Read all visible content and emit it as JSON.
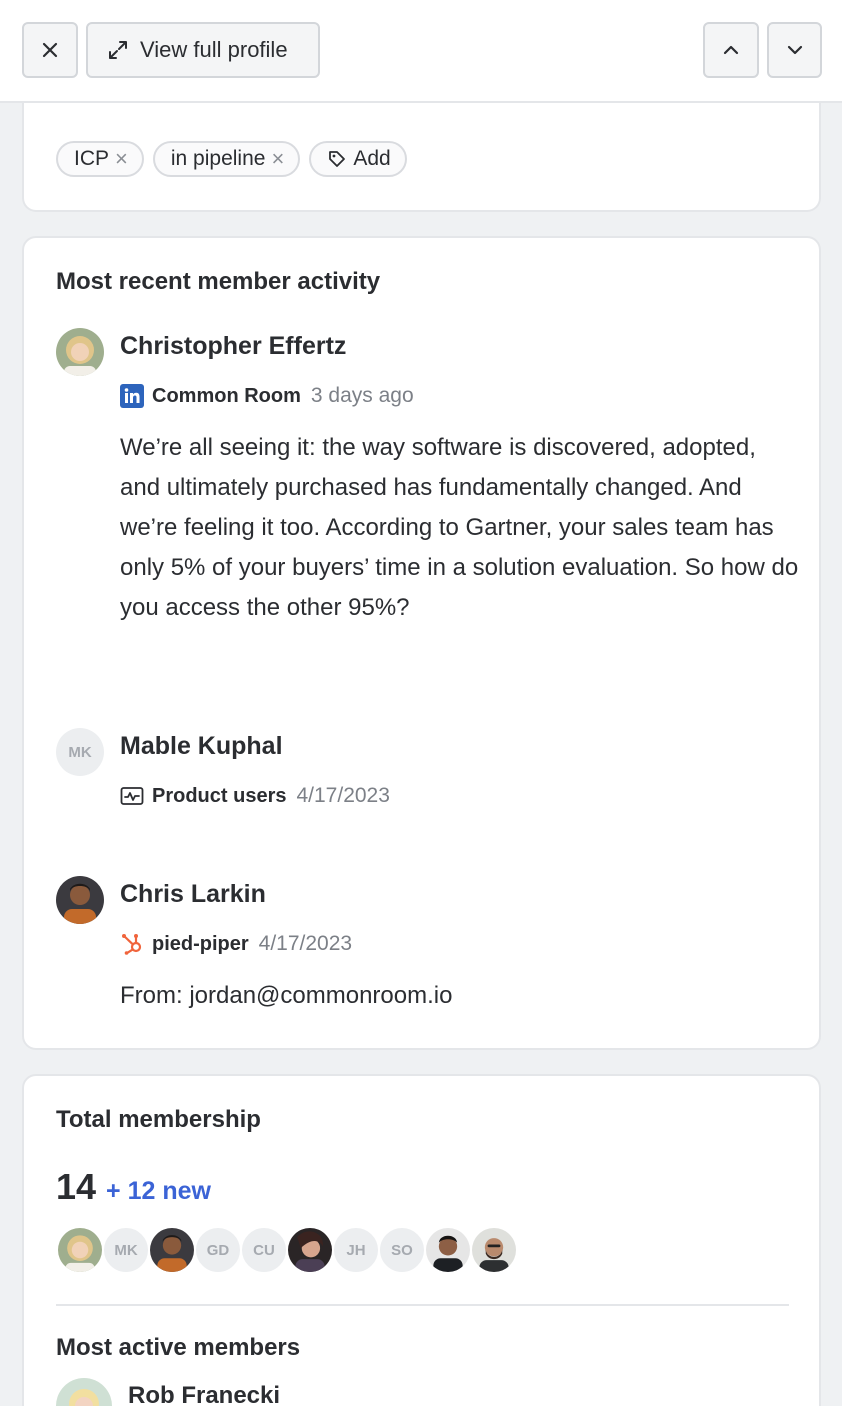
{
  "toolbar": {
    "view_full_profile_label": "View full profile"
  },
  "tags": {
    "items": [
      "ICP",
      "in pipeline"
    ],
    "add_label": "Add"
  },
  "activity": {
    "title": "Most recent member activity",
    "items": [
      {
        "name": "Christopher Effertz",
        "source": "Common Room",
        "source_icon": "linkedin-icon",
        "time": "3 days ago",
        "body": "We’re all seeing it: the way software is discovered, adopted, and ultimately purchased has fundamentally changed. And we’re feeling it too. According to Gartner, your sales team has only 5% of your buyers’ time in a solution evaluation. So how do you access the other 95%?"
      },
      {
        "name": "Mable Kuphal",
        "initials": "MK",
        "source": "Product users",
        "source_icon": "activity-monitor-icon",
        "time": "4/17/2023"
      },
      {
        "name": "Chris Larkin",
        "source": "pied-piper",
        "source_icon": "hubspot-icon",
        "time": "4/17/2023",
        "body": "From: jordan@commonroom.io"
      }
    ]
  },
  "membership": {
    "title": "Total membership",
    "count": "14",
    "new_label": "+ 12 new",
    "avatar_initials": [
      "MK",
      "GD",
      "CU",
      "JH",
      "SO"
    ]
  },
  "most_active": {
    "title": "Most active members",
    "first_member": "Rob Franecki"
  },
  "colors": {
    "accent": "#3b63d6",
    "linkedin": "#2d64bc",
    "hubspot": "#f0643c"
  }
}
